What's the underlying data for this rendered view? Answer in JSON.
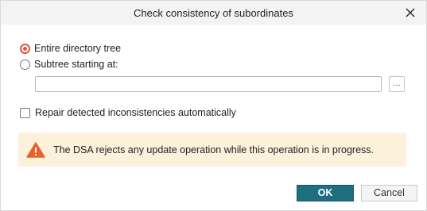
{
  "dialog": {
    "title": "Check consistency of subordinates",
    "close_icon": "close-icon"
  },
  "scope": {
    "options": [
      {
        "label": "Entire directory tree",
        "selected": true
      },
      {
        "label": "Subtree starting at:",
        "selected": false
      }
    ],
    "subtree_value": "",
    "browse_label": "..."
  },
  "repair": {
    "label": "Repair detected inconsistencies automatically",
    "checked": false
  },
  "warning": {
    "icon": "warning-icon",
    "text": "The DSA rejects any update operation while this operation is in progress.",
    "bg_color": "#fcf2db",
    "icon_color": "#e8622c"
  },
  "buttons": {
    "ok_label": "OK",
    "cancel_label": "Cancel",
    "ok_color": "#1f6f80"
  },
  "accent_color": "#e2553a"
}
